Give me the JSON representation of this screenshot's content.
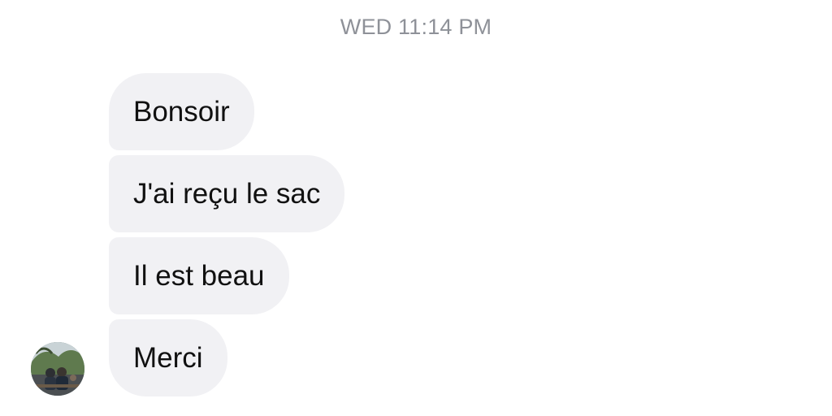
{
  "header": {
    "timestamp": "WED 11:14 PM"
  },
  "messages": [
    {
      "text": "Bonsoir"
    },
    {
      "text": "J'ai reçu le sac"
    },
    {
      "text": "Il est beau"
    },
    {
      "text": "Merci"
    }
  ],
  "sender": {
    "avatar_icon": "contact-avatar-photo"
  }
}
